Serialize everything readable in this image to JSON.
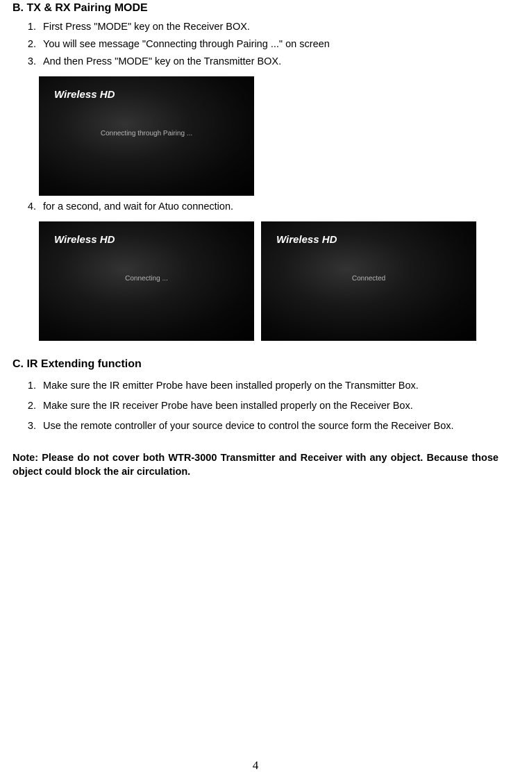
{
  "sectionB": {
    "heading": "B. TX & RX Pairing MODE",
    "steps": [
      "First Press \"MODE\" key on the Receiver BOX.",
      "You will see message \"Connecting through Pairing ...\" on screen",
      "And then Press \"MODE\" key on the Transmitter BOX.",
      "for a second, and wait for Atuo connection."
    ],
    "screens": {
      "screen1": {
        "brand": "Wireless HD",
        "msg": "Connecting through Pairing ..."
      },
      "screen2": {
        "brand": "Wireless HD",
        "msg": "Connecting ..."
      },
      "screen3": {
        "brand": "Wireless HD",
        "msg": "Connected"
      }
    }
  },
  "sectionC": {
    "heading": "C. IR Extending function",
    "steps": [
      "Make sure the IR emitter Probe have been installed properly on the Transmitter Box.",
      "Make sure the IR receiver Probe have been installed properly on the Receiver Box.",
      "Use the remote controller of your source device to control the source form the Receiver Box."
    ]
  },
  "note": "Note: Please do not cover both WTR-3000 Transmitter and Receiver with any object. Because those object could block the air circulation.",
  "pageNumber": "4"
}
